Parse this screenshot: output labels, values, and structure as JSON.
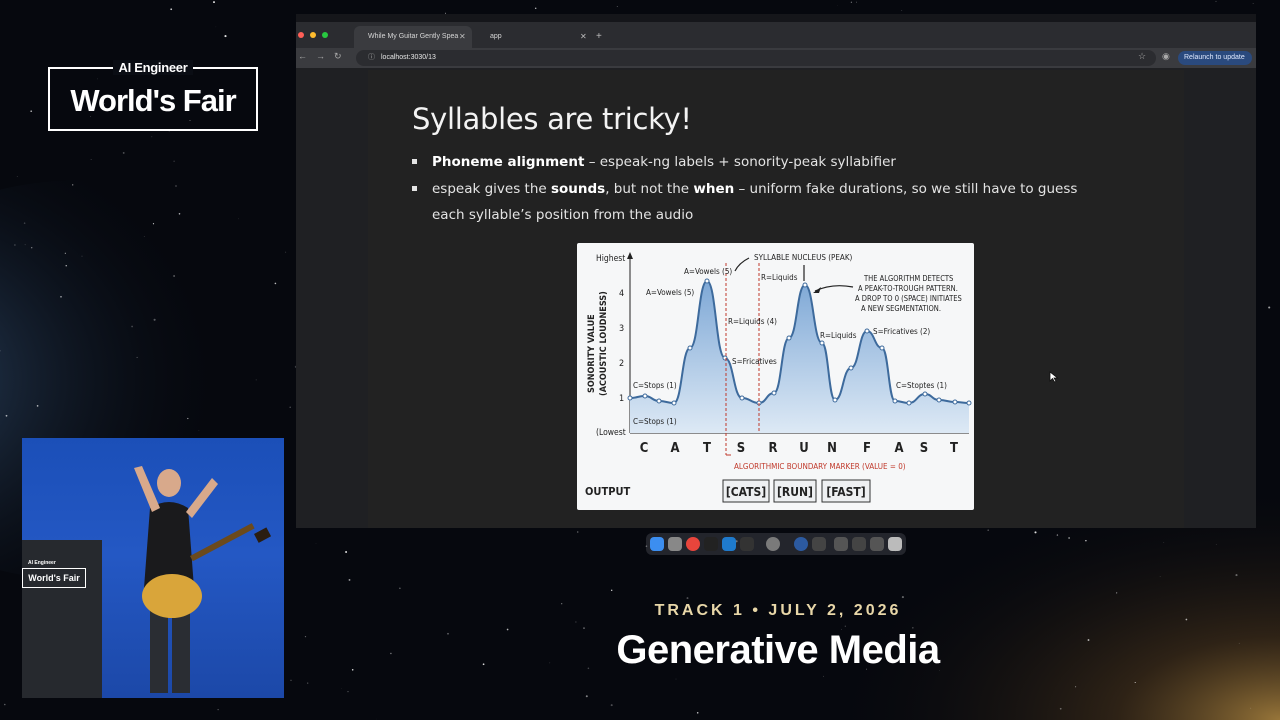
{
  "event": {
    "logo_top": "AI Engineer",
    "logo_main": "World's Fair",
    "track": "TRACK 1 • JULY 2, 2026",
    "title": "Generative Media"
  },
  "browser": {
    "tabs": [
      {
        "label": "While My Guitar Gently Spea",
        "active": true
      },
      {
        "label": "app",
        "active": false
      }
    ],
    "url": "localhost:3030/13",
    "relaunch_label": "Relaunch to update"
  },
  "slide": {
    "title": "Syllables are tricky!",
    "bullets": [
      {
        "bold": "Phoneme alignment",
        "rest": " – espeak-ng labels + sonority-peak syllabifier"
      },
      {
        "pre": "espeak gives the ",
        "bold1": "sounds",
        "mid": ", but not the ",
        "bold2": "when",
        "rest": " – uniform fake durations, so we still have to guess each syllable’s position from the audio"
      }
    ]
  },
  "figure": {
    "ylabel1": "SONORITY VALUE",
    "ylabel2": "(ACOUSTIC LOUDNESS)",
    "y_high": "Highest",
    "y_low": "(Lowest",
    "yticks": [
      "4",
      "3",
      "2",
      "1"
    ],
    "letters": [
      "C",
      "A",
      "T",
      "S",
      "R",
      "U",
      "N",
      "F",
      "A",
      "S",
      "T"
    ],
    "annotations": {
      "nucleus": "SYLLABLE NUCLEUS (PEAK)",
      "algo1": "THE ALGORITHM DETECTS",
      "algo2": "A PEAK-TO-TROUGH PATTERN.",
      "algo3": "A DROP TO 0 (SPACE) INITIATES",
      "algo4": "A NEW SEGMENTATION.",
      "vowels_top": "A=Vowels (5)",
      "vowels_left": "A=Vowels (5)",
      "r_liquids_top": "R=Liquids",
      "r_liquids_mid": "R=Liquids (4)",
      "r_liquids_right": "R=Liquids",
      "s_fricatives": "S=Fricatives",
      "s_fricatives2": "S=Fricatives (2)",
      "c_stops": "C=Stops (1)",
      "c_stops_low": "C=Stops (1)",
      "c_stoptes": "C=Stoptes (1)",
      "boundary": "ALGORITHMIC BOUNDARY MARKER (VALUE = 0)"
    },
    "output_label": "OUTPUT",
    "outputs": [
      "[CATS]",
      "[RUN]",
      "[FAST]"
    ],
    "colors": {
      "fill": "#a9c6e6",
      "line": "#3d6a9c",
      "boundary": "#c0392b"
    }
  }
}
